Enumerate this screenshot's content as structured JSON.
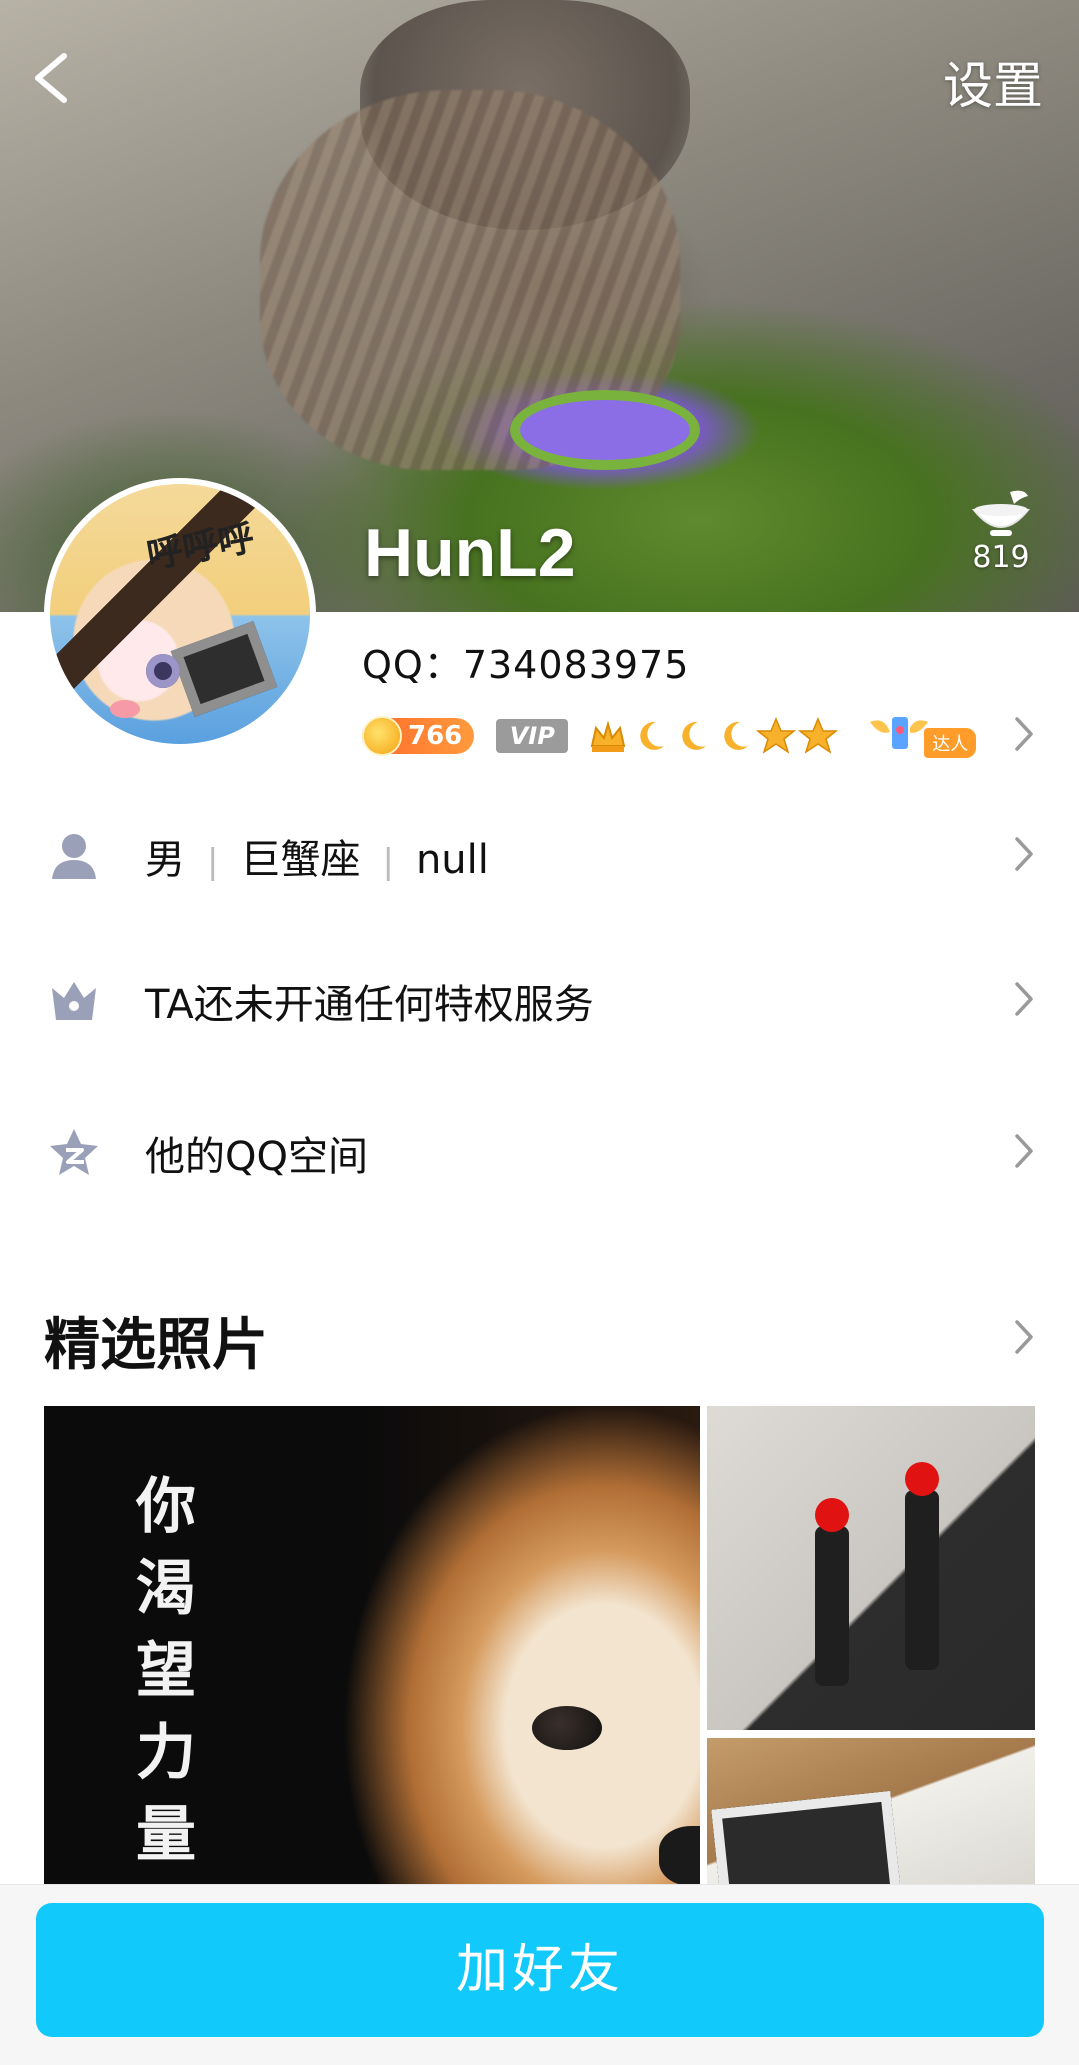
{
  "header": {
    "settings_label": "设置",
    "nickname": "HunL2",
    "like_count": "819"
  },
  "avatar": {
    "overlay_text": "呼呼呼"
  },
  "profile": {
    "qq_number": "QQ：734083975",
    "coin_value": "766",
    "vip_label": "VIP",
    "talent_label": "达人"
  },
  "rows": {
    "basic": {
      "gender": "男",
      "zodiac": "巨蟹座",
      "location": "null"
    },
    "privilege": "TA还未开通任何特权服务",
    "qzone": "他的QQ空间"
  },
  "photos": {
    "section_title": "精选照片",
    "caption": "你渴望力量"
  },
  "actions": {
    "add_friend": "加好友"
  },
  "colors": {
    "primary": "#12c9fb",
    "icon_gray": "#9aa0b8",
    "coin_orange": "#ff7a2f"
  }
}
